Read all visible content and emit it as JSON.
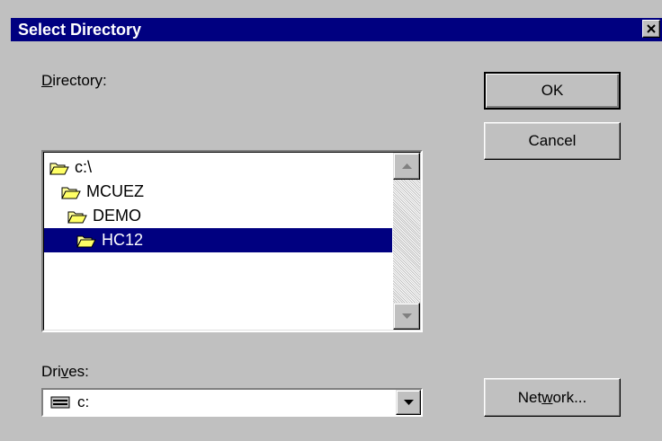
{
  "window": {
    "title": "Select Directory",
    "close_icon": "close-icon"
  },
  "directory": {
    "label_accel": "D",
    "label_rest": "irectory:",
    "items": [
      {
        "name": "c:\\",
        "icon": "open-folder-icon",
        "selected": false
      },
      {
        "name": "MCUEZ",
        "icon": "open-folder-icon",
        "selected": false
      },
      {
        "name": "DEMO",
        "icon": "open-folder-icon",
        "selected": false
      },
      {
        "name": "HC12",
        "icon": "open-folder-icon",
        "selected": true
      }
    ],
    "scroll_up_icon": "scroll-up-arrow-icon",
    "scroll_down_icon": "scroll-down-arrow-icon"
  },
  "drives": {
    "label_pre": "Dri",
    "label_accel": "v",
    "label_rest": "es:",
    "selected": "c:",
    "icon": "drive-icon",
    "dropdown_icon": "dropdown-arrow-icon"
  },
  "buttons": {
    "ok": "OK",
    "cancel": "Cancel",
    "network_pre": "Net",
    "network_accel": "w",
    "network_rest": "ork..."
  },
  "colors": {
    "dialog_bg": "#c0c0c0",
    "titlebar": "#000080",
    "selection": "#000080"
  }
}
